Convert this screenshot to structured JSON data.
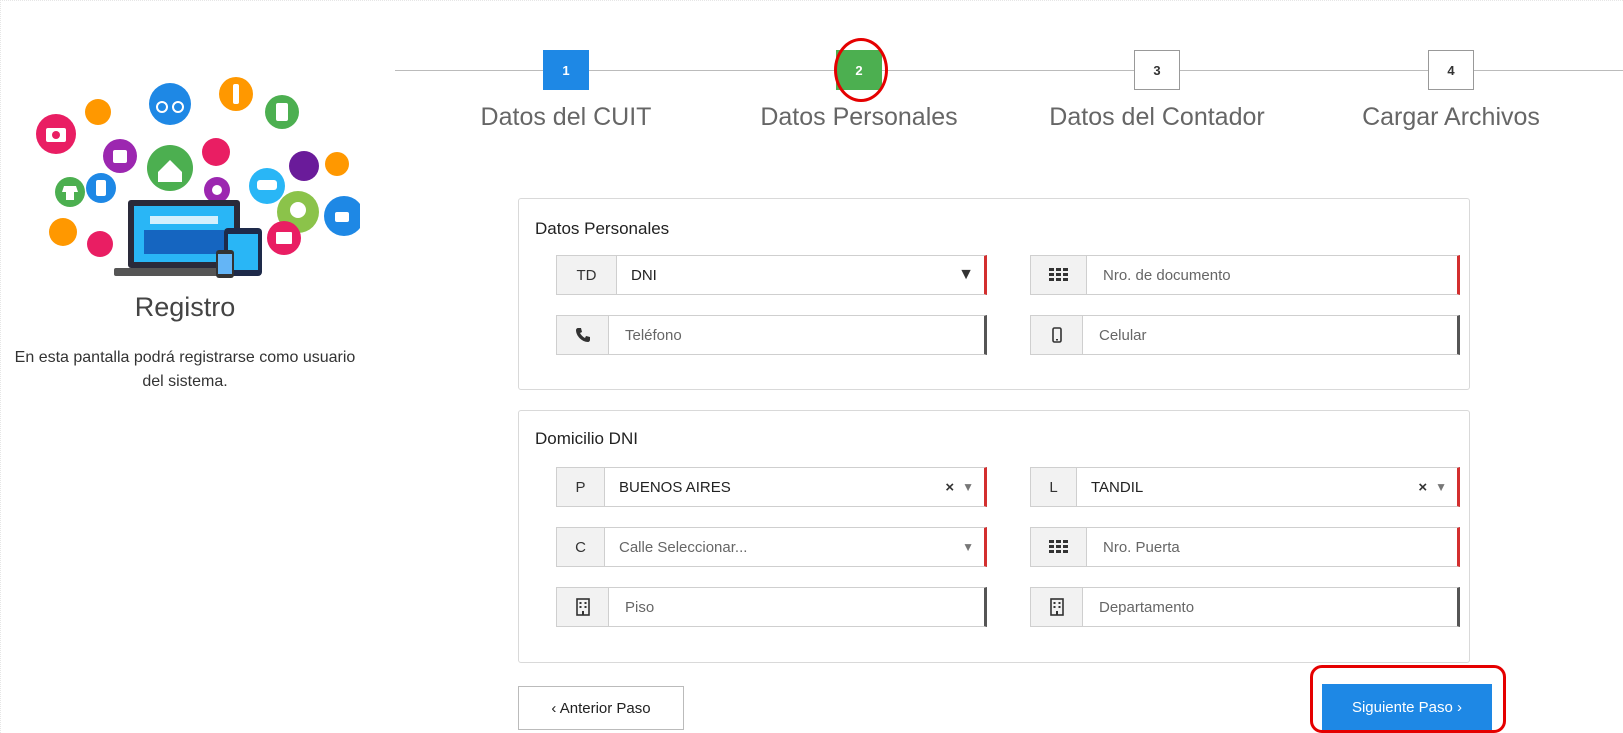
{
  "left": {
    "title": "Registro",
    "description": "En esta pantalla podrá registrarse como usuario del sistema."
  },
  "stepper": {
    "steps": [
      {
        "number": "1",
        "label": "Datos del CUIT",
        "state": "active"
      },
      {
        "number": "2",
        "label": "Datos Personales",
        "state": "completed"
      },
      {
        "number": "3",
        "label": "Datos del Contador",
        "state": "pending"
      },
      {
        "number": "4",
        "label": "Cargar Archivos",
        "state": "pending"
      }
    ]
  },
  "personal": {
    "title": "Datos Personales",
    "doc_type_addon": "TD",
    "doc_type_value": "DNI",
    "doc_number_placeholder": "Nro. de documento",
    "phone_placeholder": "Teléfono",
    "mobile_placeholder": "Celular"
  },
  "address": {
    "title": "Domicilio DNI",
    "province_addon": "P",
    "province_value": "BUENOS AIRES",
    "city_addon": "L",
    "city_value": "TANDIL",
    "street_addon": "C",
    "street_placeholder": "Calle Seleccionar...",
    "door_placeholder": "Nro. Puerta",
    "floor_placeholder": "Piso",
    "apartment_placeholder": "Departamento"
  },
  "buttons": {
    "prev": "‹ Anterior Paso",
    "next": "Siguiente Paso ›"
  },
  "colors": {
    "primary": "#1e88e5",
    "success": "#4caf50",
    "required": "#d32f2f",
    "highlight": "#e50000"
  }
}
